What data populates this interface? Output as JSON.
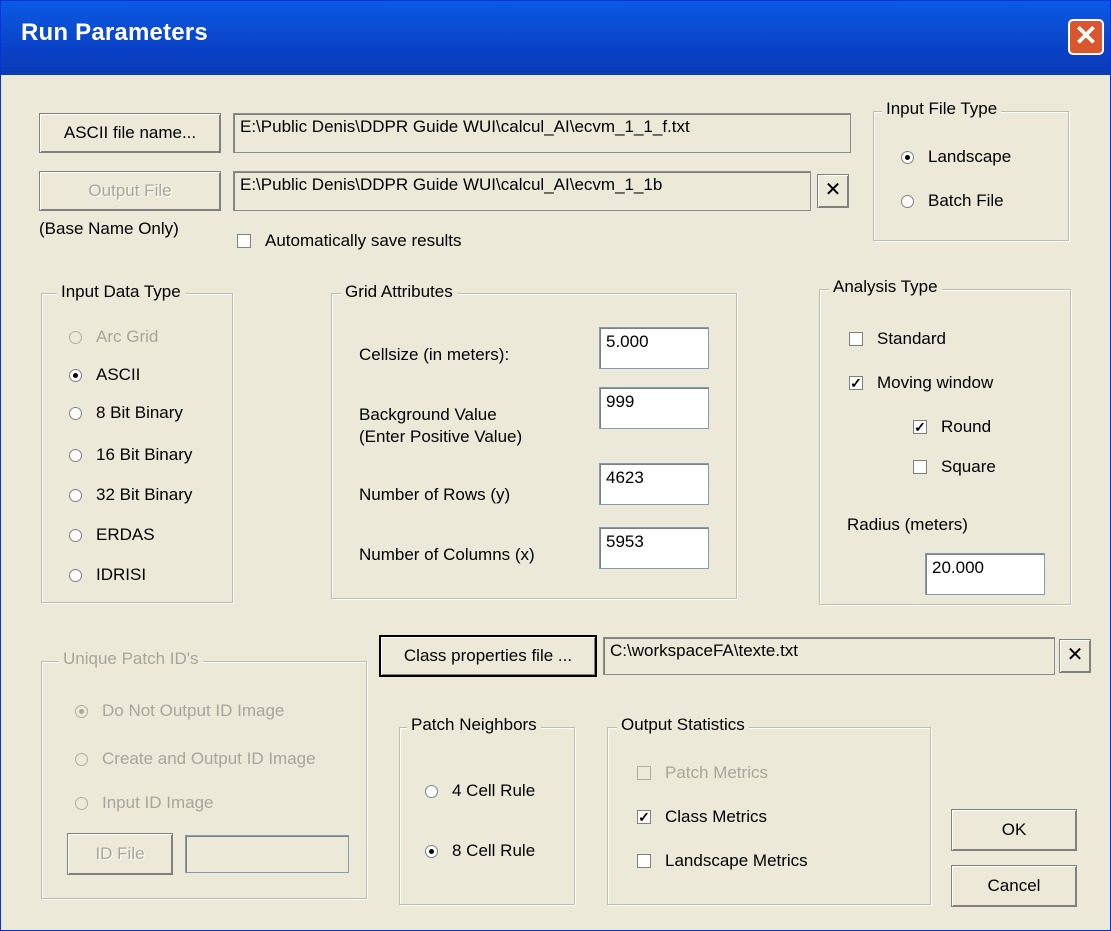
{
  "window": {
    "title": "Run Parameters",
    "close_glyph": "✕"
  },
  "files": {
    "ascii_button": "ASCII file name...",
    "ascii_path": "E:\\Public Denis\\DDPR Guide WUI\\calcul_AI\\ecvm_1_1_f.txt",
    "output_button": "Output File",
    "output_path": "E:\\Public Denis\\DDPR Guide WUI\\calcul_AI\\ecvm_1_1b",
    "output_clear": "✕",
    "base_name_note": "(Base Name Only)",
    "auto_save_label": "Automatically save results",
    "auto_save_checked": false
  },
  "input_file_type": {
    "title": "Input File Type",
    "options": [
      "Landscape",
      "Batch File"
    ],
    "selected": "Landscape"
  },
  "input_data_type": {
    "title": "Input Data Type",
    "options": [
      "Arc Grid",
      "ASCII",
      "8 Bit Binary",
      "16 Bit Binary",
      "32 Bit Binary",
      "ERDAS",
      "IDRISI"
    ],
    "selected": "ASCII"
  },
  "grid_attributes": {
    "title": "Grid Attributes",
    "cellsize_label": "Cellsize (in meters):",
    "cellsize_value": "5.000",
    "background_label_1": "Background Value",
    "background_label_2": "(Enter Positive Value)",
    "background_value": "999",
    "rows_label": "Number of Rows (y)",
    "rows_value": "4623",
    "cols_label": "Number of Columns (x)",
    "cols_value": "5953"
  },
  "analysis_type": {
    "title": "Analysis Type",
    "standard_label": "Standard",
    "standard_checked": false,
    "moving_label": "Moving window",
    "moving_checked": true,
    "round_label": "Round",
    "round_checked": true,
    "square_label": "Square",
    "square_checked": false,
    "radius_label": "Radius (meters)",
    "radius_value": "20.000"
  },
  "class_props": {
    "button": "Class properties file ...",
    "path": "C:\\workspaceFA\\texte.txt",
    "clear": "✕"
  },
  "unique_patch": {
    "title": "Unique Patch ID's",
    "options": [
      "Do Not Output ID Image",
      "Create and Output ID Image",
      "Input ID Image"
    ],
    "selected": "Do Not Output ID Image",
    "id_file_button": "ID File",
    "id_file_value": ""
  },
  "patch_neighbors": {
    "title": "Patch Neighbors",
    "options": [
      "4 Cell Rule",
      "8 Cell Rule"
    ],
    "selected": "8 Cell Rule"
  },
  "output_statistics": {
    "title": "Output Statistics",
    "patch_label": "Patch Metrics",
    "patch_checked": false,
    "class_label": "Class Metrics",
    "class_checked": true,
    "landscape_label": "Landscape Metrics",
    "landscape_checked": false
  },
  "actions": {
    "ok": "OK",
    "cancel": "Cancel"
  },
  "colors": {
    "title_bar": "#0a4fd6",
    "dialog_bg": "#ece9d8",
    "close_button": "#d9562e",
    "disabled_text": "#a8a69a"
  }
}
